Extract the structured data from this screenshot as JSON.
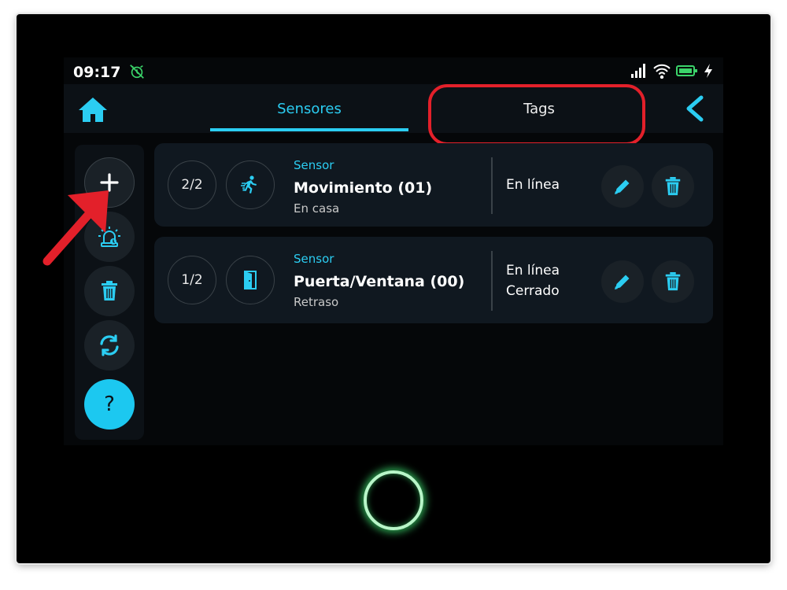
{
  "status_bar": {
    "time": "09:17"
  },
  "tabs": [
    {
      "label": "Sensores",
      "active": true
    },
    {
      "label": "Tags",
      "active": false
    }
  ],
  "sidebar": {
    "buttons": [
      "add-icon",
      "siren-icon",
      "trash-icon",
      "sync-icon",
      "help-icon"
    ],
    "help_label": "?"
  },
  "sensors": [
    {
      "count": "2/2",
      "icon": "running-person-icon",
      "kind": "Sensor",
      "name": "Movimiento (01)",
      "sub": "En casa",
      "status_line1": "En línea",
      "status_line2": ""
    },
    {
      "count": "1/2",
      "icon": "door-icon",
      "kind": "Sensor",
      "name": "Puerta/Ventana (00)",
      "sub": "Retraso",
      "status_line1": "En línea",
      "status_line2": "Cerrado"
    }
  ],
  "colors": {
    "accent": "#2bcdf2",
    "highlight": "#e3202a",
    "background": "#050709",
    "card": "#101820",
    "home_ring": "#3cdc6e"
  }
}
